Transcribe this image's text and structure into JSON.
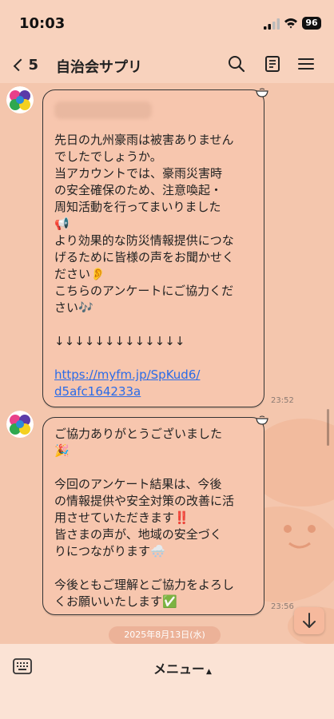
{
  "status_bar": {
    "time": "10:03",
    "battery": "96"
  },
  "header": {
    "back_count": "5",
    "title": "自治会サプリ"
  },
  "messages": [
    {
      "lines": [
        "先日の九州豪雨は被害ありません",
        "でしたでしょうか。",
        "当アカウントでは、豪雨災害時",
        "の安全確保のため、注意喚起・",
        "周知活動を行ってまいりました",
        "📢",
        "より効果的な防災情報提供につな",
        "げるために皆様の声をお聞かせく",
        "ださい👂",
        "こちらのアンケートにご協力くだ",
        "さい🎶",
        "",
        "↓↓↓↓↓↓↓↓↓↓↓↓↓",
        ""
      ],
      "link_lines": [
        "https://myfm.jp/SpKud6/",
        "d5afc164233a"
      ],
      "time": "23:52"
    },
    {
      "lines": [
        "ご協力ありがとうございました",
        "🎉",
        "",
        "今回のアンケート結果は、今後",
        "の情報提供や安全対策の改善に活",
        "用させていただきます‼️",
        "皆さまの声が、地域の安全づく",
        "りにつながります🌨️",
        "",
        "今後ともご理解とご協力をよろし",
        "くお願いいたします✅"
      ],
      "time": "23:56"
    }
  ],
  "date_separator": "2025年8月13日(水)",
  "bottom": {
    "menu_label": "メニュー"
  },
  "colors": {
    "background": "#f4c6ad",
    "bubble": "#f7c6ae",
    "link": "#2b6be8",
    "bar": "#fbe3d5"
  },
  "icons": [
    "search-icon",
    "note-icon",
    "hamburger-icon",
    "keyboard-icon",
    "arrow-down-icon",
    "bowl-icon"
  ]
}
